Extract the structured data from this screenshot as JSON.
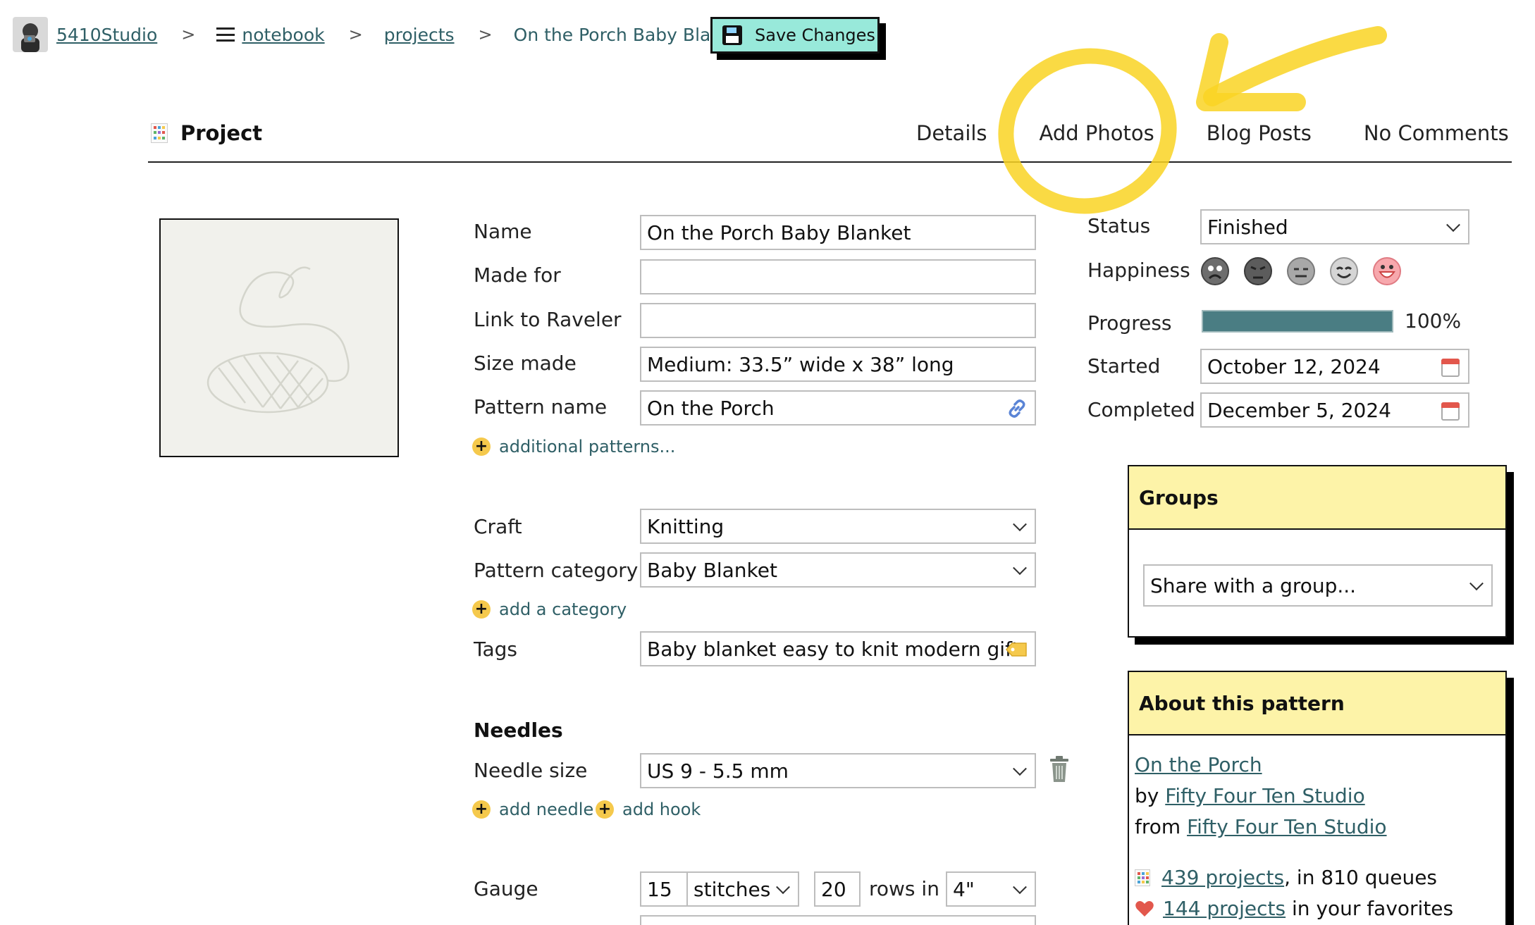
{
  "breadcrumb": {
    "user": "5410Studio",
    "notebook": "notebook",
    "projects": "projects",
    "current": "On the Porch Baby Blanket",
    "separator": ">"
  },
  "toolbar": {
    "save_label": "Save Changes"
  },
  "section": {
    "title": "Project",
    "tabs": [
      "Details",
      "Add Photos",
      "Blog Posts",
      "No Comments"
    ]
  },
  "form": {
    "name": {
      "label": "Name",
      "value": "On the Porch Baby Blanket"
    },
    "made_for": {
      "label": "Made for",
      "value": ""
    },
    "link_raveler": {
      "label": "Link to Raveler",
      "value": ""
    },
    "size_made": {
      "label": "Size made",
      "value": "Medium: 33.5” wide x 38” long"
    },
    "pattern_name": {
      "label": "Pattern name",
      "value": "On the Porch"
    },
    "additional_patterns": "additional patterns...",
    "craft": {
      "label": "Craft",
      "value": "Knitting"
    },
    "pattern_category": {
      "label": "Pattern category",
      "value": "Baby Blanket"
    },
    "add_category": "add a category",
    "tags": {
      "label": "Tags",
      "value": "Baby blanket easy to knit modern gift"
    },
    "needles_heading": "Needles",
    "needle_size": {
      "label": "Needle size",
      "value": "US 9 - 5.5 mm"
    },
    "add_needle": "add needle",
    "add_hook": "add hook",
    "gauge": {
      "label": "Gauge",
      "stitches_value": "15",
      "stitches_unit": "stitches",
      "rows_value": "20",
      "rows_text": "rows in",
      "measure": "4\""
    }
  },
  "status_panel": {
    "status": {
      "label": "Status",
      "value": "Finished"
    },
    "happiness": {
      "label": "Happiness",
      "faces": [
        "very-unhappy-face-icon",
        "unhappy-face-icon",
        "neutral-face-icon",
        "happy-face-icon",
        "very-happy-face-icon"
      ]
    },
    "progress": {
      "label": "Progress",
      "value": 100,
      "text": "100%"
    },
    "started": {
      "label": "Started",
      "value": "October 12, 2024"
    },
    "completed": {
      "label": "Completed",
      "value": "December 5, 2024"
    }
  },
  "groups": {
    "title": "Groups",
    "select_value": "Share with a group..."
  },
  "about_pattern": {
    "title": "About this pattern",
    "pattern_link": "On the Porch",
    "by_label": "by",
    "designer": "Fifty Four Ten Studio",
    "from_label": "from",
    "source": "Fifty Four Ten Studio",
    "projects_link": "439 projects",
    "queues_text": ", in 810 queues",
    "favorites_link": "144 projects",
    "favorites_text": " in your favorites"
  },
  "colors": {
    "link": "#2f5f66",
    "save_button": "#98e9da",
    "box_header": "#fdf3a8",
    "progress": "#4a7d83",
    "add_plus": "#f5c94c",
    "annotation": "#f9d423"
  }
}
